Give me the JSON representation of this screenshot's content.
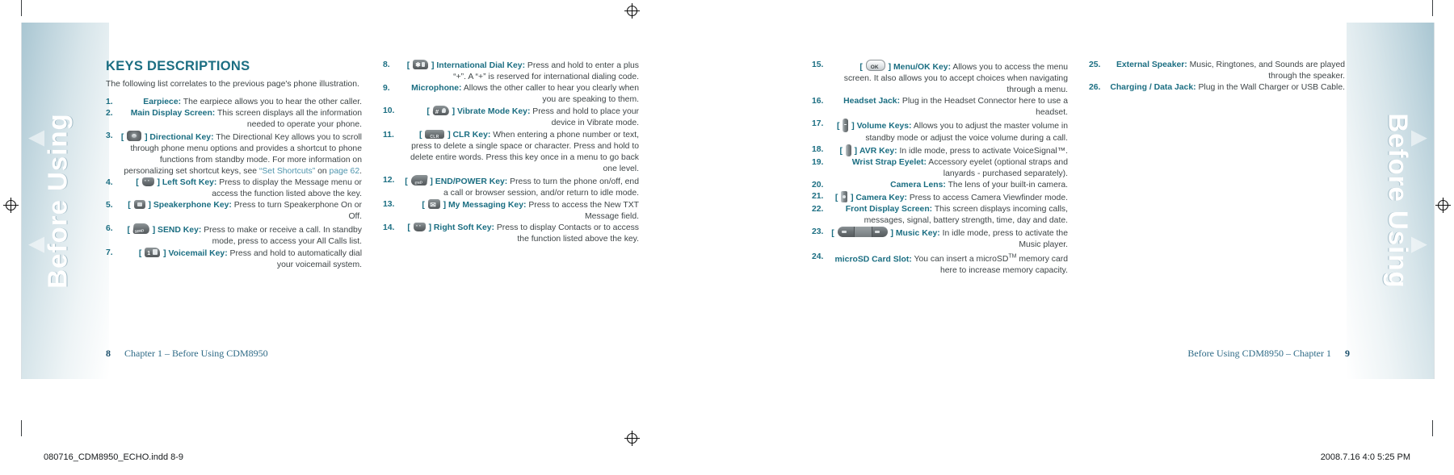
{
  "document": {
    "footer_left": "080716_CDM8950_ECHO.indd   8-9",
    "footer_right": "2008.7.16   4:0 5:25 PM",
    "side_tab_left": "Before Using",
    "side_tab_right": "Before Using"
  },
  "left_page": {
    "heading": "KEYS DESCRIPTIONS",
    "lead": "The following list correlates to the previous page's phone illustration.",
    "footer_page": "8",
    "footer_text": "Chapter 1 – Before Using CDM8950"
  },
  "right_page": {
    "footer_page": "9",
    "footer_text": "Before Using CDM8950 – Chapter 1"
  },
  "items": [
    {
      "num": "1.",
      "icon": "",
      "term": "Earpiece:",
      "desc": " The earpiece allows you to hear the other caller."
    },
    {
      "num": "2.",
      "icon": "",
      "term": "Main Display Screen:",
      "desc": " This screen displays all the information needed to operate your phone."
    },
    {
      "num": "3.",
      "icon": "directional-key-icon",
      "term": "Directional Key:",
      "desc": " The Directional Key allows you to scroll through phone menu options and provides a shortcut to phone functions from standby mode. For more information on personalizing set shortcut keys, see “Set Shortcuts” on page 62.",
      "link_text": "“Set Shortcuts”",
      "link_page": "page 62"
    },
    {
      "num": "4.",
      "icon": "left-soft-key-icon",
      "term": "Left Soft Key:",
      "desc": " Press to display the Message menu or access the function listed above the key."
    },
    {
      "num": "5.",
      "icon": "speakerphone-key-icon",
      "term": "Speakerphone Key:",
      "desc": " Press to turn Speakerphone On or Off."
    },
    {
      "num": "6.",
      "icon": "send-key-icon",
      "term": "SEND Key:",
      "desc": " Press to make or receive a call. In standby mode, press to access your All Calls list."
    },
    {
      "num": "7.",
      "icon": "voicemail-key-icon",
      "term": "Voicemail Key:",
      "desc": " Press and hold to automatically dial your voicemail system."
    },
    {
      "num": "8.",
      "icon": "international-dial-key-icon",
      "term": "International Dial Key:",
      "desc": " Press and hold to enter a plus “+”. A “+” is reserved for international dialing code."
    },
    {
      "num": "9.",
      "icon": "",
      "term": "Microphone:",
      "desc": " Allows the other caller to hear you clearly when you are speaking to them."
    },
    {
      "num": "10.",
      "icon": "vibrate-mode-key-icon",
      "term": "Vibrate Mode Key:",
      "desc": " Press and hold to place your device in Vibrate mode."
    },
    {
      "num": "11.",
      "icon": "clr-key-icon",
      "term": "CLR Key:",
      "desc": " When entering a phone number or text, press to delete a single space or character. Press and hold to delete entire words. Press this key once in a menu to go back one level."
    },
    {
      "num": "12.",
      "icon": "end-power-key-icon",
      "term": "END/POWER Key:",
      "desc": " Press to turn the phone on/off, end a call or browser session, and/or return to idle mode."
    },
    {
      "num": "13.",
      "icon": "my-messaging-key-icon",
      "term": "My Messaging Key:",
      "desc": " Press to access the New TXT Message field."
    },
    {
      "num": "14.",
      "icon": "right-soft-key-icon",
      "term": "Right Soft Key:",
      "desc": " Press to display Contacts or to access the function listed above the key."
    },
    {
      "num": "15.",
      "icon": "menu-ok-key-icon",
      "term": "Menu/OK Key:",
      "desc": " Allows you to access the menu screen. It also allows you to accept choices when navigating through a menu."
    },
    {
      "num": "16.",
      "icon": "",
      "term": "Headset Jack:",
      "desc": " Plug in the Headset Connector here to use a headset."
    },
    {
      "num": "17.",
      "icon": "volume-keys-icon",
      "term": "Volume Keys:",
      "desc": " Allows you to adjust the master volume in standby mode or adjust the voice volume during a call."
    },
    {
      "num": "18.",
      "icon": "avr-key-icon",
      "term": "AVR Key:",
      "desc": " In idle mode, press to activate VoiceSignal™."
    },
    {
      "num": "19.",
      "icon": "",
      "term": "Wrist Strap Eyelet:",
      "desc": " Accessory eyelet (optional straps and lanyards - purchased separately)."
    },
    {
      "num": "20.",
      "icon": "",
      "term": "Camera Lens:",
      "desc": " The lens of your built-in camera."
    },
    {
      "num": "21.",
      "icon": "camera-key-icon",
      "term": "Camera Key:",
      "desc": " Press to access Camera Viewfinder mode."
    },
    {
      "num": "22.",
      "icon": "",
      "term": "Front Display Screen:",
      "desc": " This screen displays incoming calls, messages, signal, battery strength, time, day and date."
    },
    {
      "num": "23.",
      "icon": "music-key-icon",
      "term": "Music Key:",
      "desc": " In idle mode, press to activate the Music player."
    },
    {
      "num": "24.",
      "icon": "",
      "term": "microSD Card Slot:",
      "desc": " You can insert a microSD",
      "desc_sup": "TM",
      "desc2": " memory card here to increase memory capacity."
    },
    {
      "num": "25.",
      "icon": "",
      "term": "External Speaker:",
      "desc": " Music, Ringtones, and Sounds are played through the speaker."
    },
    {
      "num": "26.",
      "icon": "",
      "term": "Charging / Data Jack:",
      "desc": " Plug in the Wall Charger or USB Cable."
    }
  ],
  "colors": {
    "accent": "#1b6e82",
    "link": "#4f95ad",
    "body": "#3e4547",
    "footer": "#2e6a86"
  }
}
